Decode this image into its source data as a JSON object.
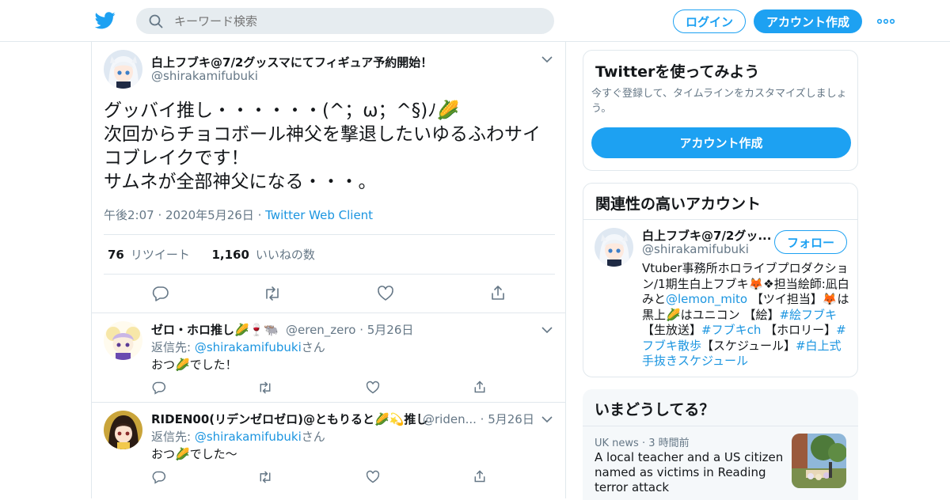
{
  "header": {
    "search_placeholder": "キーワード検索",
    "login_label": "ログイン",
    "signup_label": "アカウント作成"
  },
  "tweet": {
    "display_name": "白上フブキ@7/2グッスマにてフィギュア予約開始！",
    "handle": "@shirakamifubuki",
    "text": "グッバイ推し・・・・・・(^；ω；^§)ﾉ🌽\n次回からチョコボール神父を撃退したいゆるふわサイコブレイクです！\nサムネが全部神父になる・・・。",
    "time": "午後2:07",
    "date": "2020年5月26日",
    "client": "Twitter Web Client",
    "retweet_count": "76",
    "retweet_label": "リツイート",
    "like_count": "1,160",
    "like_label": "いいねの数"
  },
  "replies": [
    {
      "display_name": "ゼロ・ホロ推し🌽🍷🐃",
      "handle": "@eren_zero",
      "date": "5月26日",
      "reply_to_prefix": "返信先: ",
      "reply_to_handle": "@shirakamifubuki",
      "reply_to_suffix": "さん",
      "text": "おつ🌽でした！"
    },
    {
      "display_name": "RIDEN00(リデンゼロゼロ)@ともりると🌽💫推し",
      "handle": "@riden...",
      "date": "5月26日",
      "reply_to_prefix": "返信先: ",
      "reply_to_handle": "@shirakamifubuki",
      "reply_to_suffix": "さん",
      "text": "おつ🌽でした〜"
    }
  ],
  "sidebar": {
    "try_title": "Twitterを使ってみよう",
    "try_desc": "今すぐ登録して、タイムラインをカスタマイズしましょう。",
    "try_button": "アカウント作成",
    "related_title": "関連性の高いアカウント",
    "related_name": "白上フブキ@7/2グッ...",
    "related_handle": "@shirakamifubuki",
    "follow_label": "フォロー",
    "bio": {
      "part1": "Vtuber事務所ホロライブプロダクション/1期生白上フブキ🦊❖担当絵師:凪白みと",
      "mention": "@lemon_mito",
      "part2": " 【ツイ担当】🦊は黒上🌽はユニコン 【絵】",
      "tag1": "#絵フブキ",
      "part3": "【生放送】",
      "tag2": "#フブキch",
      "part4": " 【ホロリー】",
      "tag3": "#フブキ散歩",
      "part5": "【スケジュール】",
      "tag4": "#白上式手抜きスケジュール"
    },
    "trends_title": "いまどうしてる？",
    "trend_source": "UK news",
    "trend_time": "3 時間前",
    "trend_headline": "A local teacher and a US citizen named as victims in Reading terror attack"
  },
  "colors": {
    "accent": "#1da1f2",
    "link": "#1b95e0",
    "muted": "#657786",
    "border": "#e1e8ed"
  }
}
